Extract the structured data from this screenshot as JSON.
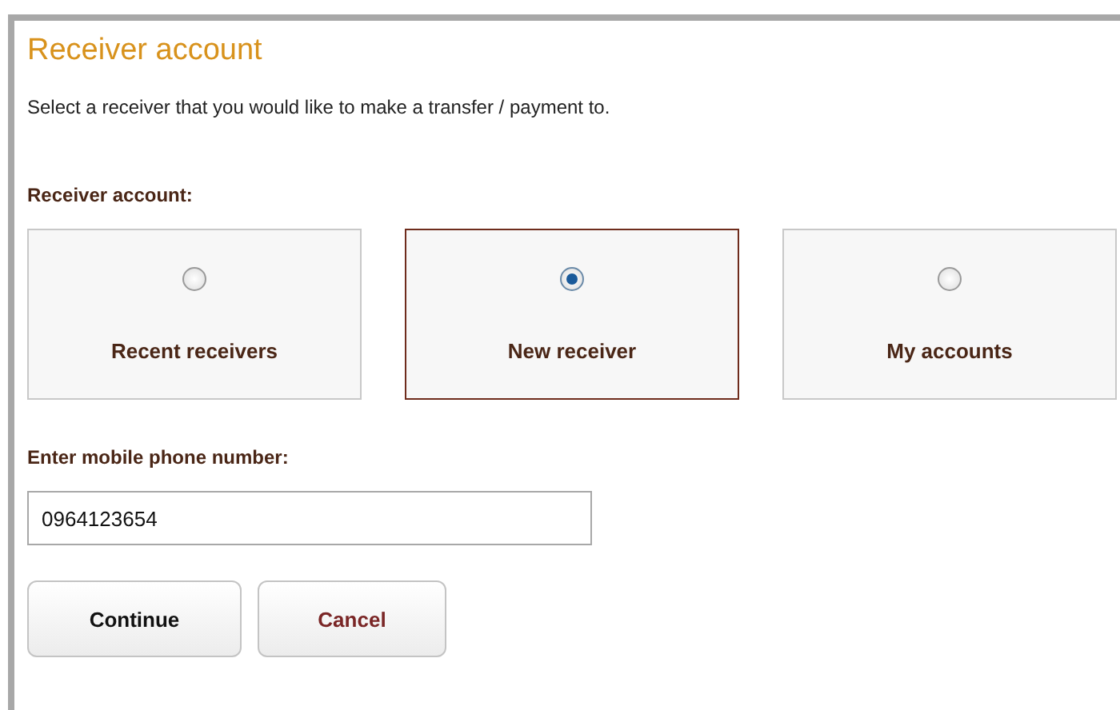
{
  "title": "Receiver account",
  "intro": "Select a receiver that you would like to make a transfer / payment to.",
  "receiver_label": "Receiver account:",
  "options": [
    {
      "label": "Recent receivers",
      "selected": false
    },
    {
      "label": "New receiver",
      "selected": true
    },
    {
      "label": "My accounts",
      "selected": false
    }
  ],
  "phone": {
    "label": "Enter mobile phone number:",
    "value": "0964123654"
  },
  "buttons": [
    {
      "label": "Continue",
      "kind": "primary"
    },
    {
      "label": "Cancel",
      "kind": "cancel"
    }
  ]
}
